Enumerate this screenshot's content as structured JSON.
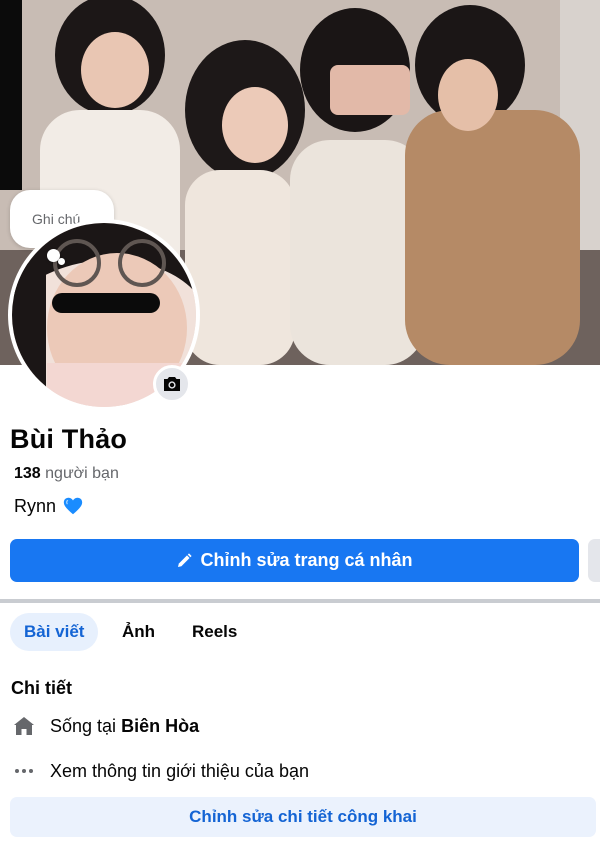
{
  "profile": {
    "note_placeholder": "Ghi chú...",
    "name": "Bùi Thảo",
    "friend_count": "138",
    "friend_label": "người bạn",
    "bio_text": "Rynn",
    "bio_emoji": "blue-heart-icon"
  },
  "actions": {
    "edit_profile_label": "Chỉnh sửa trang cá nhân"
  },
  "tabs": [
    {
      "label": "Bài viết",
      "active": true
    },
    {
      "label": "Ảnh",
      "active": false
    },
    {
      "label": "Reels",
      "active": false
    }
  ],
  "details": {
    "title": "Chi tiết",
    "lives_prefix": "Sống tại",
    "lives_city": "Biên Hòa",
    "intro_text": "Xem thông tin giới thiệu của bạn",
    "edit_public_label": "Chỉnh sửa chi tiết công khai"
  },
  "colors": {
    "accent": "#1877f2",
    "accent_text": "#1464d4",
    "secondary_text": "#65676b"
  }
}
